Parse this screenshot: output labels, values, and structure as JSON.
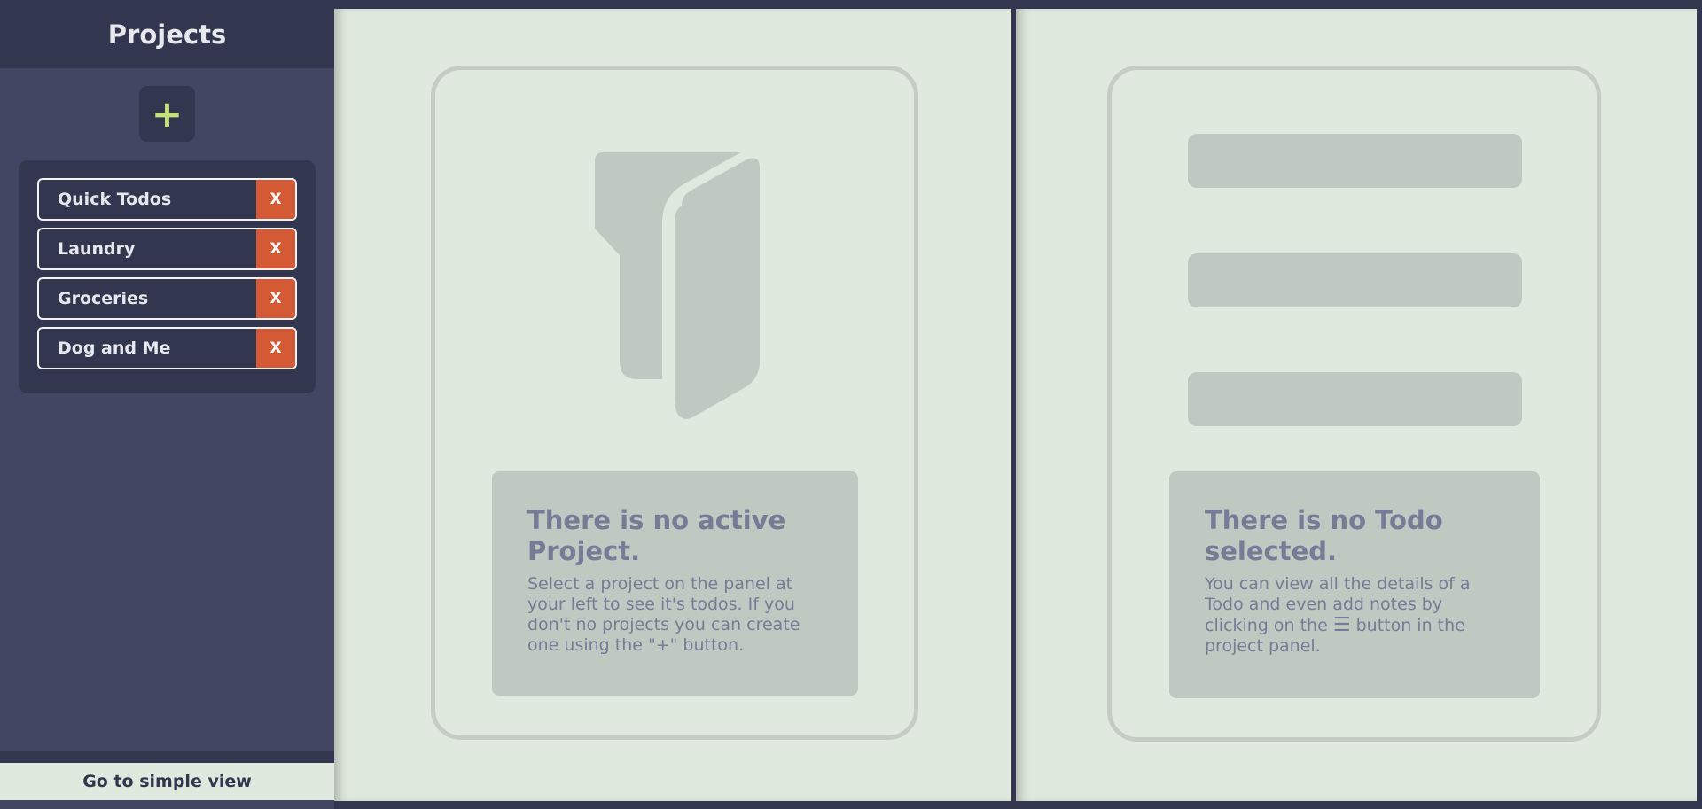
{
  "sidebar": {
    "title": "Projects",
    "add_button": "+",
    "projects": [
      {
        "label": "Quick Todos",
        "delete": "X"
      },
      {
        "label": "Laundry",
        "delete": "X"
      },
      {
        "label": "Groceries",
        "delete": "X"
      },
      {
        "label": "Dog and Me",
        "delete": "X"
      }
    ],
    "footer_link": "Go to simple view"
  },
  "project_panel": {
    "icon": "folder-icon",
    "empty_title": "There is no active Project.",
    "empty_body": "Select a project on the panel at your left to see it's todos. If you don't no projects you can create one using the \"+\" button."
  },
  "todo_panel": {
    "empty_title": "There is no Todo selected.",
    "empty_body_before": "You can view all the details of a Todo and even add notes by clicking on the",
    "menu_icon": "☰",
    "empty_body_after": "button in the project panel."
  },
  "colors": {
    "sidebar_bg": "#424662",
    "dark": "#33364f",
    "panel_bg": "#dfe9dd",
    "accent_green": "#c4e17a",
    "delete_orange": "#d45a36",
    "muted_text": "#767b96",
    "placeholder": "#bfc9c2"
  }
}
